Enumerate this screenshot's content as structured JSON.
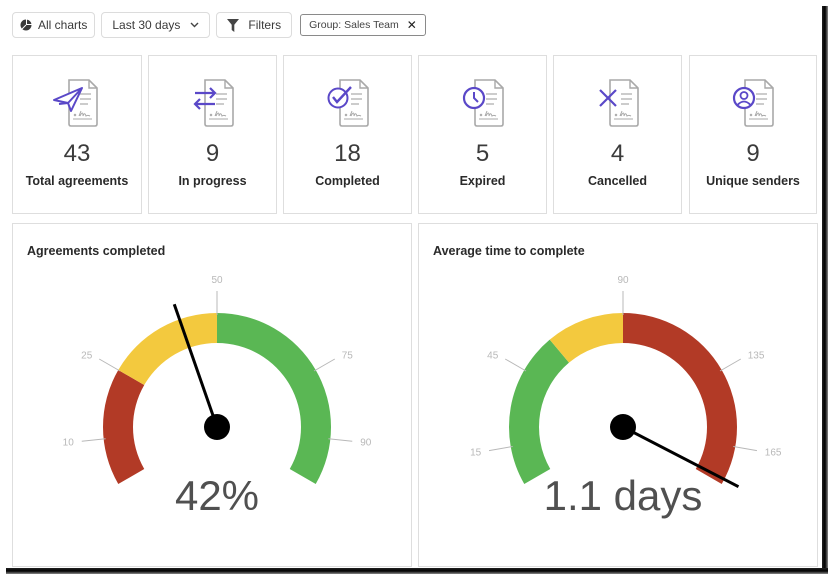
{
  "toolbar": {
    "all_charts": {
      "label": "All charts",
      "icon": "pie-chart-icon"
    },
    "date_range": {
      "label": "Last 30 days",
      "icon": "chevron-down-icon"
    },
    "filters": {
      "label": "Filters",
      "icon": "funnel-icon"
    },
    "active_filter": {
      "label": "Group: Sales Team",
      "remove_icon": "close-icon",
      "remove_glyph": "✕"
    }
  },
  "stats": [
    {
      "value": "43",
      "label": "Total agreements",
      "icon": "paper-plane-document-icon"
    },
    {
      "value": "9",
      "label": "In progress",
      "icon": "arrows-exchange-document-icon"
    },
    {
      "value": "18",
      "label": "Completed",
      "icon": "check-circle-document-icon"
    },
    {
      "value": "5",
      "label": "Expired",
      "icon": "clock-document-icon"
    },
    {
      "value": "4",
      "label": "Cancelled",
      "icon": "x-document-icon"
    },
    {
      "value": "9",
      "label": "Unique senders",
      "icon": "user-circle-document-icon"
    }
  ],
  "colors": {
    "icon_accent": "#5a48c8",
    "red": "#b23a26",
    "yellow": "#f3c93e",
    "green": "#5ab754",
    "tick": "#b8b8b8",
    "value_text": "#505050",
    "needle": "#000000"
  },
  "chart_data": [
    {
      "type": "gauge",
      "title": "Agreements completed",
      "min": 0,
      "max": 100,
      "value": 42,
      "value_label": "42%",
      "ticks": [
        10,
        25,
        50,
        75,
        90
      ],
      "bands": [
        {
          "from": 0,
          "to": 25,
          "color": "#b23a26"
        },
        {
          "from": 25,
          "to": 50,
          "color": "#f3c93e"
        },
        {
          "from": 50,
          "to": 100,
          "color": "#5ab754"
        }
      ]
    },
    {
      "type": "gauge",
      "title": "Average time to complete",
      "min": 0,
      "max": 180,
      "value": 178,
      "value_label": "1.1 days",
      "ticks": [
        15,
        45,
        90,
        135,
        165
      ],
      "bands": [
        {
          "from": 0,
          "to": 60,
          "color": "#5ab754"
        },
        {
          "from": 60,
          "to": 90,
          "color": "#f3c93e"
        },
        {
          "from": 90,
          "to": 180,
          "color": "#b23a26"
        }
      ]
    }
  ]
}
